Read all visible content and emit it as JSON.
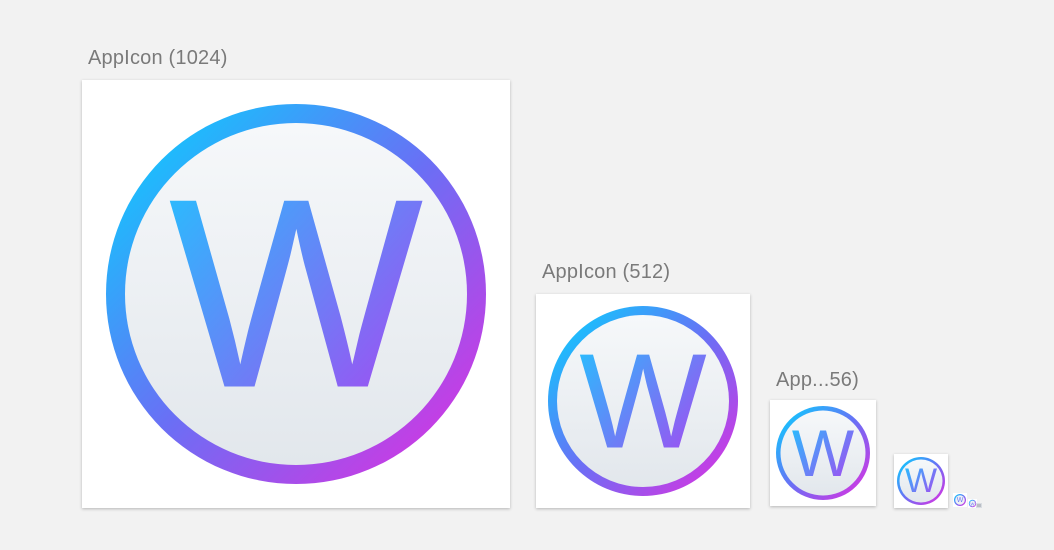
{
  "icons": [
    {
      "label": "AppIcon (1024)",
      "glyph": "W"
    },
    {
      "label": "AppIcon (512)",
      "glyph": "W"
    },
    {
      "label": "App...56)",
      "glyph": "W"
    },
    {
      "label": "",
      "glyph": "W"
    },
    {
      "label": "",
      "glyph": "W"
    },
    {
      "label": "",
      "glyph": "W"
    }
  ],
  "colors": {
    "background": "#f2f2f2",
    "label": "#7a7a7a",
    "ring_start": "#00d4ff",
    "ring_mid": "#7a63f6",
    "ring_end": "#e22be0",
    "face_top": "#f5f7fa",
    "face_bottom": "#e3e8ee"
  }
}
